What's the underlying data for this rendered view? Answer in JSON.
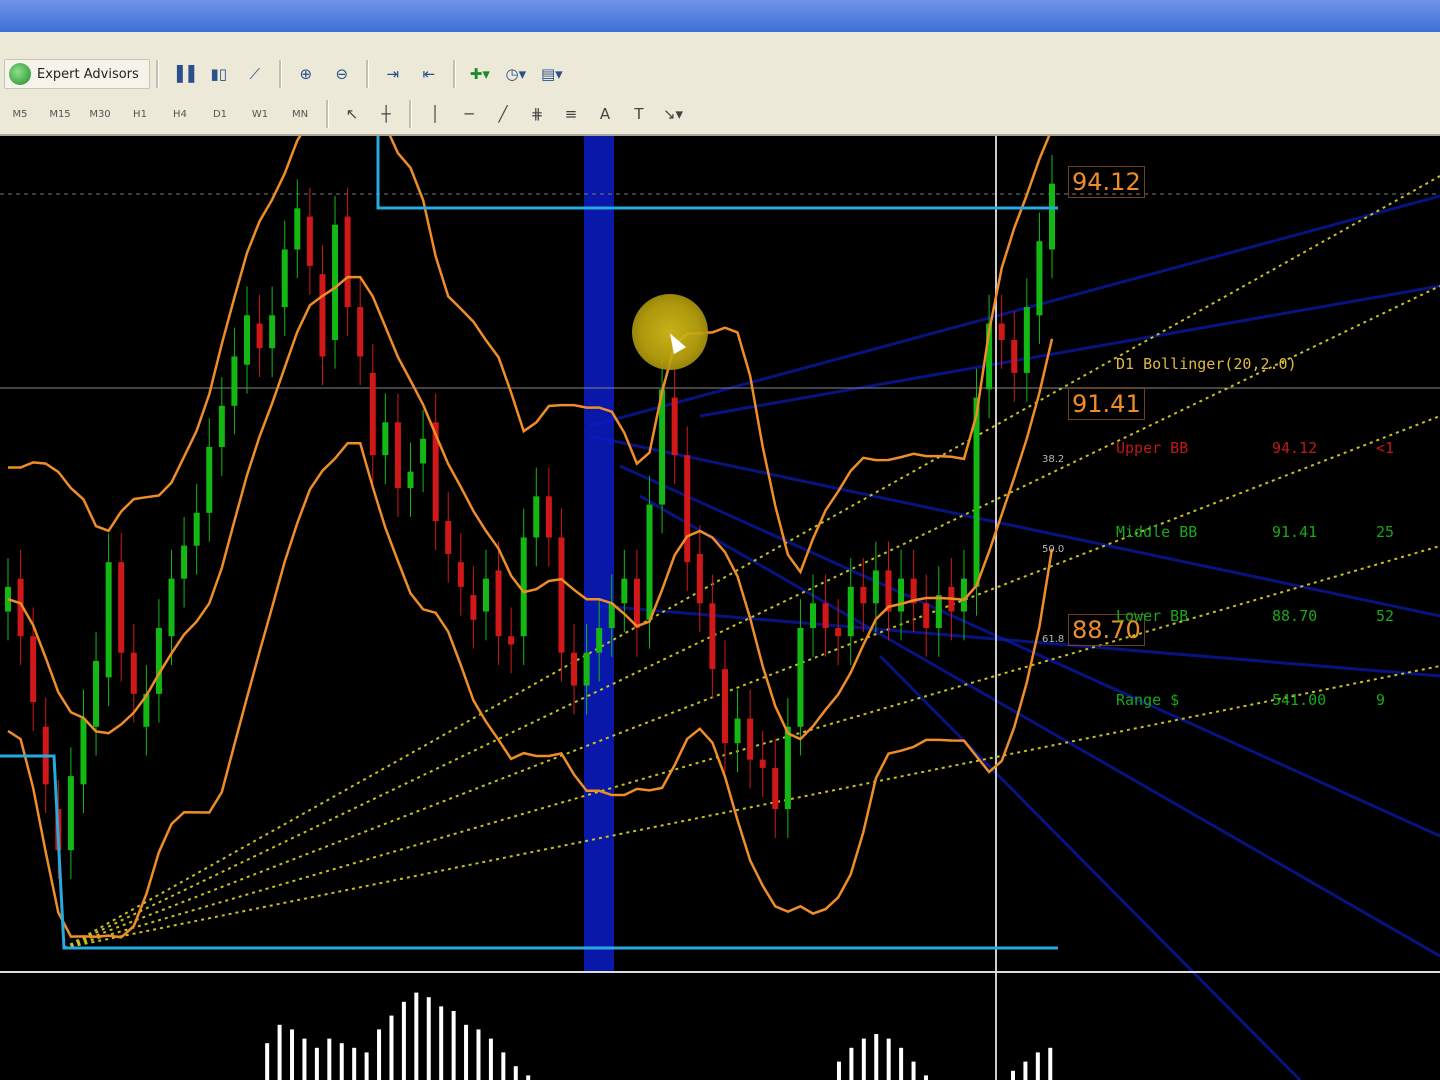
{
  "toolbar": {
    "expert_advisors_label": "Expert Advisors",
    "timeframes": [
      "M5",
      "M15",
      "M30",
      "H1",
      "H4",
      "D1",
      "W1",
      "MN"
    ]
  },
  "chart": {
    "price_labels": {
      "high": "94.12",
      "mid": "91.41",
      "low": "88.70"
    },
    "fib_labels": [
      "38.2",
      "50.0",
      "61.8"
    ],
    "info_panel": {
      "title": "D1 Bollinger(20,2.0)",
      "rows": [
        {
          "name": "Upper BB",
          "value": "94.12",
          "extra": "<1"
        },
        {
          "name": "Middle BB",
          "value": "91.41",
          "extra": "25"
        },
        {
          "name": "Lower BB",
          "value": "88.70",
          "extra": "52"
        },
        {
          "name": "Range $",
          "value": "541.00",
          "extra": "9"
        }
      ]
    },
    "colors": {
      "background": "#000000",
      "up_candle": "#14b814",
      "down_candle": "#d01818",
      "bollinger": "#ef8d28",
      "box": "#2aa8e0",
      "fib_fan": "#c8c020",
      "histogram": "#ffffff"
    }
  },
  "chart_data": {
    "type": "candlestick",
    "indicator": "Bollinger(20,2.0)",
    "bollinger": {
      "upper": 94.12,
      "middle": 91.41,
      "lower": 88.7
    },
    "candles": [
      {
        "o": 88.9,
        "c": 89.2
      },
      {
        "o": 89.3,
        "c": 88.6
      },
      {
        "o": 88.6,
        "c": 87.8
      },
      {
        "o": 87.5,
        "c": 86.8
      },
      {
        "o": 86.5,
        "c": 86.0
      },
      {
        "o": 86.0,
        "c": 86.9
      },
      {
        "o": 86.8,
        "c": 87.6
      },
      {
        "o": 87.5,
        "c": 88.3
      },
      {
        "o": 88.1,
        "c": 89.5
      },
      {
        "o": 89.5,
        "c": 88.4
      },
      {
        "o": 88.4,
        "c": 87.9
      },
      {
        "o": 87.5,
        "c": 87.9
      },
      {
        "o": 87.9,
        "c": 88.7
      },
      {
        "o": 88.6,
        "c": 89.3
      },
      {
        "o": 89.3,
        "c": 89.7
      },
      {
        "o": 89.7,
        "c": 90.1
      },
      {
        "o": 90.1,
        "c": 90.9
      },
      {
        "o": 90.9,
        "c": 91.4
      },
      {
        "o": 91.4,
        "c": 92.0
      },
      {
        "o": 91.9,
        "c": 92.5
      },
      {
        "o": 92.4,
        "c": 92.1
      },
      {
        "o": 92.1,
        "c": 92.5
      },
      {
        "o": 92.6,
        "c": 93.3
      },
      {
        "o": 93.3,
        "c": 93.8
      },
      {
        "o": 93.7,
        "c": 93.1
      },
      {
        "o": 93.0,
        "c": 92.0
      },
      {
        "o": 92.2,
        "c": 93.6
      },
      {
        "o": 93.7,
        "c": 92.6
      },
      {
        "o": 92.6,
        "c": 92.0
      },
      {
        "o": 91.8,
        "c": 90.8
      },
      {
        "o": 90.8,
        "c": 91.2
      },
      {
        "o": 91.2,
        "c": 90.4
      },
      {
        "o": 90.4,
        "c": 90.6
      },
      {
        "o": 90.7,
        "c": 91.0
      },
      {
        "o": 91.2,
        "c": 90.0
      },
      {
        "o": 90.0,
        "c": 89.6
      },
      {
        "o": 89.5,
        "c": 89.2
      },
      {
        "o": 89.1,
        "c": 88.8
      },
      {
        "o": 88.9,
        "c": 89.3
      },
      {
        "o": 89.4,
        "c": 88.6
      },
      {
        "o": 88.6,
        "c": 88.5
      },
      {
        "o": 88.6,
        "c": 89.8
      },
      {
        "o": 89.8,
        "c": 90.3
      },
      {
        "o": 90.3,
        "c": 89.8
      },
      {
        "o": 89.8,
        "c": 88.4
      },
      {
        "o": 88.4,
        "c": 88.0
      },
      {
        "o": 88.0,
        "c": 88.4
      },
      {
        "o": 88.4,
        "c": 88.7
      },
      {
        "o": 88.7,
        "c": 89.0
      },
      {
        "o": 89.0,
        "c": 89.3
      },
      {
        "o": 89.3,
        "c": 88.7
      },
      {
        "o": 88.8,
        "c": 90.2
      },
      {
        "o": 90.2,
        "c": 91.6
      },
      {
        "o": 91.5,
        "c": 90.8
      },
      {
        "o": 90.8,
        "c": 89.5
      },
      {
        "o": 89.6,
        "c": 89.0
      },
      {
        "o": 89.0,
        "c": 88.2
      },
      {
        "o": 88.2,
        "c": 87.3
      },
      {
        "o": 87.3,
        "c": 87.6
      },
      {
        "o": 87.6,
        "c": 87.1
      },
      {
        "o": 87.1,
        "c": 87.0
      },
      {
        "o": 87.0,
        "c": 86.5
      },
      {
        "o": 86.5,
        "c": 87.5
      },
      {
        "o": 87.5,
        "c": 88.7
      },
      {
        "o": 88.7,
        "c": 89.0
      },
      {
        "o": 89.0,
        "c": 88.7
      },
      {
        "o": 88.7,
        "c": 88.6
      },
      {
        "o": 88.6,
        "c": 89.2
      },
      {
        "o": 89.2,
        "c": 89.0
      },
      {
        "o": 89.0,
        "c": 89.4
      },
      {
        "o": 89.4,
        "c": 88.9
      },
      {
        "o": 88.9,
        "c": 89.3
      },
      {
        "o": 89.3,
        "c": 89.0
      },
      {
        "o": 89.0,
        "c": 88.7
      },
      {
        "o": 88.7,
        "c": 89.1
      },
      {
        "o": 89.2,
        "c": 88.9
      },
      {
        "o": 88.9,
        "c": 89.3
      },
      {
        "o": 89.2,
        "c": 91.5
      },
      {
        "o": 91.6,
        "c": 92.4
      },
      {
        "o": 92.4,
        "c": 92.2
      },
      {
        "o": 92.2,
        "c": 91.8
      },
      {
        "o": 91.8,
        "c": 92.6
      },
      {
        "o": 92.5,
        "c": 93.4
      },
      {
        "o": 93.3,
        "c": 94.1
      }
    ],
    "histogram": [
      0,
      0,
      0,
      0,
      0,
      0,
      0,
      0,
      0,
      0,
      0,
      0,
      0.4,
      0.6,
      0.55,
      0.45,
      0.35,
      0.45,
      0.4,
      0.35,
      0.3,
      0.55,
      0.7,
      0.85,
      0.95,
      0.9,
      0.8,
      0.75,
      0.6,
      0.55,
      0.45,
      0.3,
      0.15,
      0.05,
      0,
      0,
      0,
      0,
      0,
      0,
      0,
      0,
      0,
      0,
      0,
      0,
      0,
      0,
      0,
      0,
      0,
      0,
      0,
      0,
      0,
      0,
      0,
      0,
      0.2,
      0.35,
      0.45,
      0.5,
      0.45,
      0.35,
      0.2,
      0.05,
      0,
      0,
      0,
      0,
      0,
      0,
      0.1,
      0.2,
      0.3,
      0.35,
      0.3,
      0.2,
      0.15,
      0.1,
      0.3,
      0.6,
      0.7,
      0.8,
      0.9
    ]
  }
}
